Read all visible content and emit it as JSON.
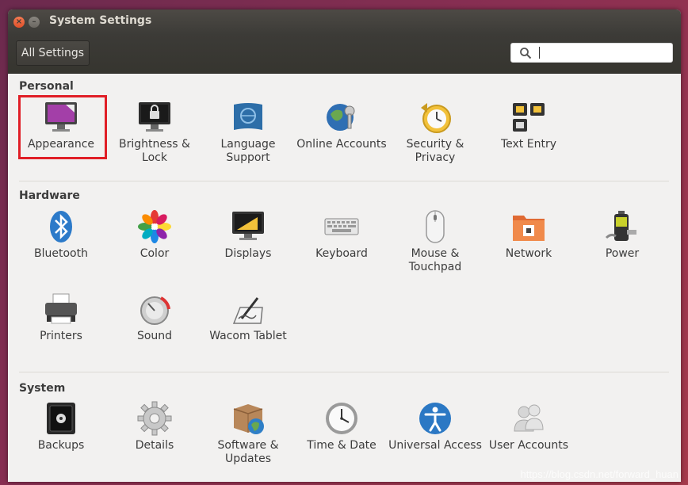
{
  "window": {
    "title": "System Settings"
  },
  "toolbar": {
    "all_settings_label": "All Settings",
    "search_value": ""
  },
  "sections": {
    "personal": {
      "title": "Personal",
      "items": [
        {
          "label": "Appearance"
        },
        {
          "label": "Brightness & Lock"
        },
        {
          "label": "Language Support"
        },
        {
          "label": "Online Accounts"
        },
        {
          "label": "Security & Privacy"
        },
        {
          "label": "Text Entry"
        }
      ]
    },
    "hardware": {
      "title": "Hardware",
      "items": [
        {
          "label": "Bluetooth"
        },
        {
          "label": "Color"
        },
        {
          "label": "Displays"
        },
        {
          "label": "Keyboard"
        },
        {
          "label": "Mouse & Touchpad"
        },
        {
          "label": "Network"
        },
        {
          "label": "Power"
        },
        {
          "label": "Printers"
        },
        {
          "label": "Sound"
        },
        {
          "label": "Wacom Tablet"
        }
      ]
    },
    "system": {
      "title": "System",
      "items": [
        {
          "label": "Backups"
        },
        {
          "label": "Details"
        },
        {
          "label": "Software & Updates"
        },
        {
          "label": "Time & Date"
        },
        {
          "label": "Universal Access"
        },
        {
          "label": "User Accounts"
        }
      ]
    }
  },
  "watermark": "https://blog.csdn.net/forward_huan",
  "colors": {
    "titlebar": "#3c3b37",
    "close_button": "#e95420",
    "selection_outline": "#e01e26",
    "content_bg": "#f2f1f0"
  }
}
